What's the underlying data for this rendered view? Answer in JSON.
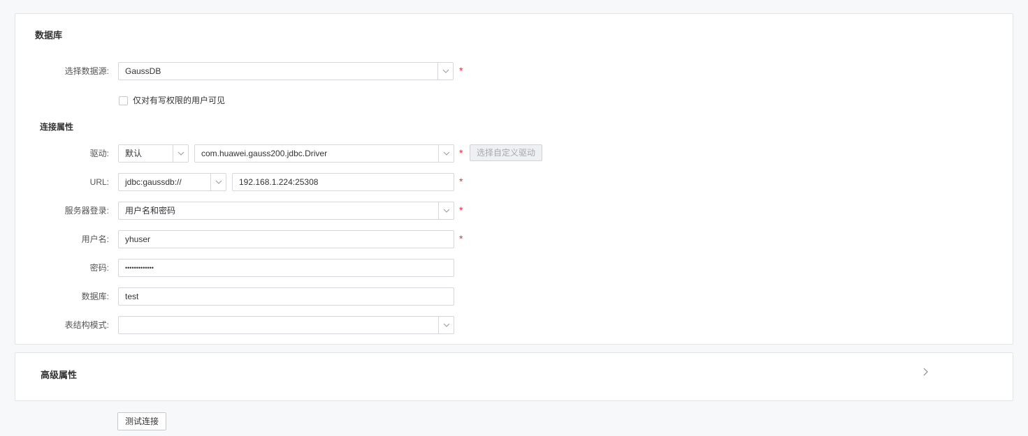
{
  "database_section": {
    "title": "数据库",
    "datasource": {
      "label": "选择数据源:",
      "value": "GaussDB",
      "required": "*"
    },
    "visibility_checkbox": {
      "label": "仅对有写权限的用户可见",
      "checked": false
    }
  },
  "connection_section": {
    "title": "连接属性",
    "driver": {
      "label": "驱动:",
      "type_value": "默认",
      "class_value": "com.huawei.gauss200.jdbc.Driver",
      "required": "*",
      "custom_button": "选择自定义驱动"
    },
    "url": {
      "label": "URL:",
      "prefix_value": "jdbc:gaussdb://",
      "host_value": "192.168.1.224:25308",
      "required": "*"
    },
    "server_login": {
      "label": "服务器登录:",
      "value": "用户名和密码",
      "required": "*"
    },
    "username": {
      "label": "用户名:",
      "value": "yhuser",
      "required": "*"
    },
    "password": {
      "label": "密码:",
      "value": "•••••••••••••"
    },
    "database": {
      "label": "数据库:",
      "value": "test"
    },
    "schema": {
      "label": "表结构模式:",
      "value": ""
    }
  },
  "advanced_section": {
    "title": "高级属性"
  },
  "footer": {
    "test_button": "测试连接"
  },
  "colors": {
    "required": "#e0333a",
    "border": "#d4d7dc",
    "background": "#f7f8fa"
  }
}
